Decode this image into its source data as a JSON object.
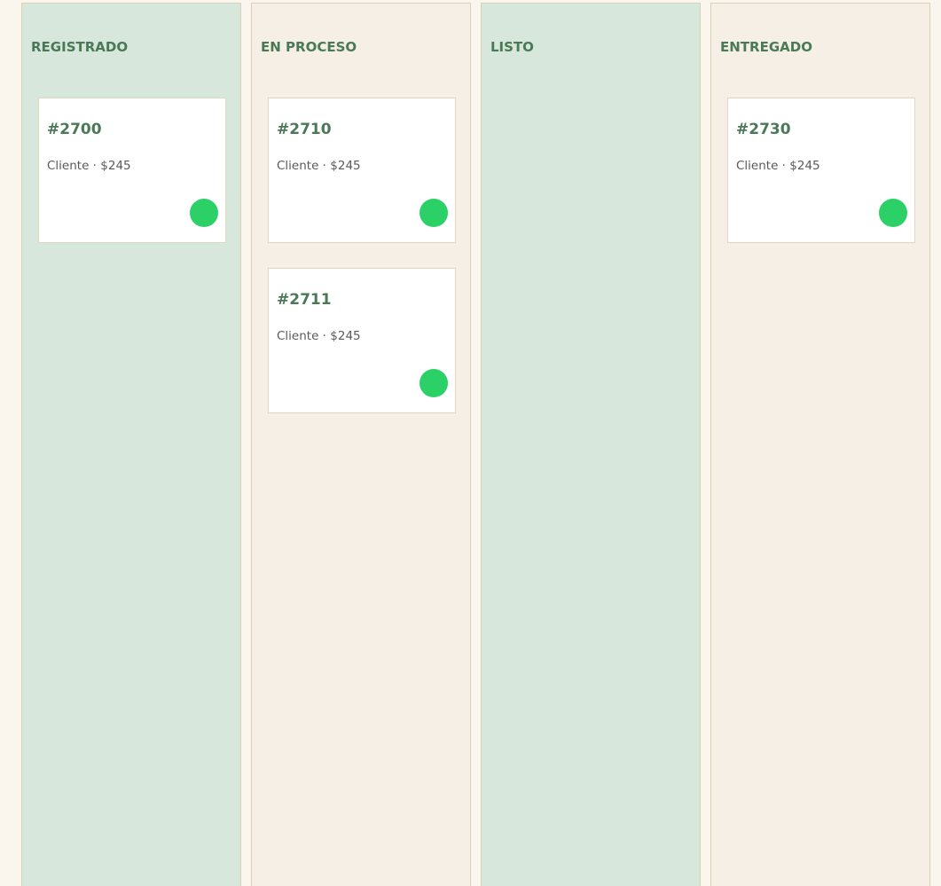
{
  "columns": [
    {
      "title": "REGISTRADO",
      "cards": [
        {
          "id": "#2700",
          "sub": "Cliente · $245"
        }
      ]
    },
    {
      "title": "EN PROCESO",
      "cards": [
        {
          "id": "#2710",
          "sub": "Cliente · $245"
        },
        {
          "id": "#2711",
          "sub": "Cliente · $245"
        }
      ]
    },
    {
      "title": "LISTO",
      "cards": []
    },
    {
      "title": "ENTREGADO",
      "cards": [
        {
          "id": "#2730",
          "sub": "Cliente · $245"
        }
      ]
    }
  ],
  "colors": {
    "column_green": "#d7e7dc",
    "column_beige": "#f5efe6",
    "accent_text": "#4a7a55",
    "status_dot": "#2bd066"
  }
}
